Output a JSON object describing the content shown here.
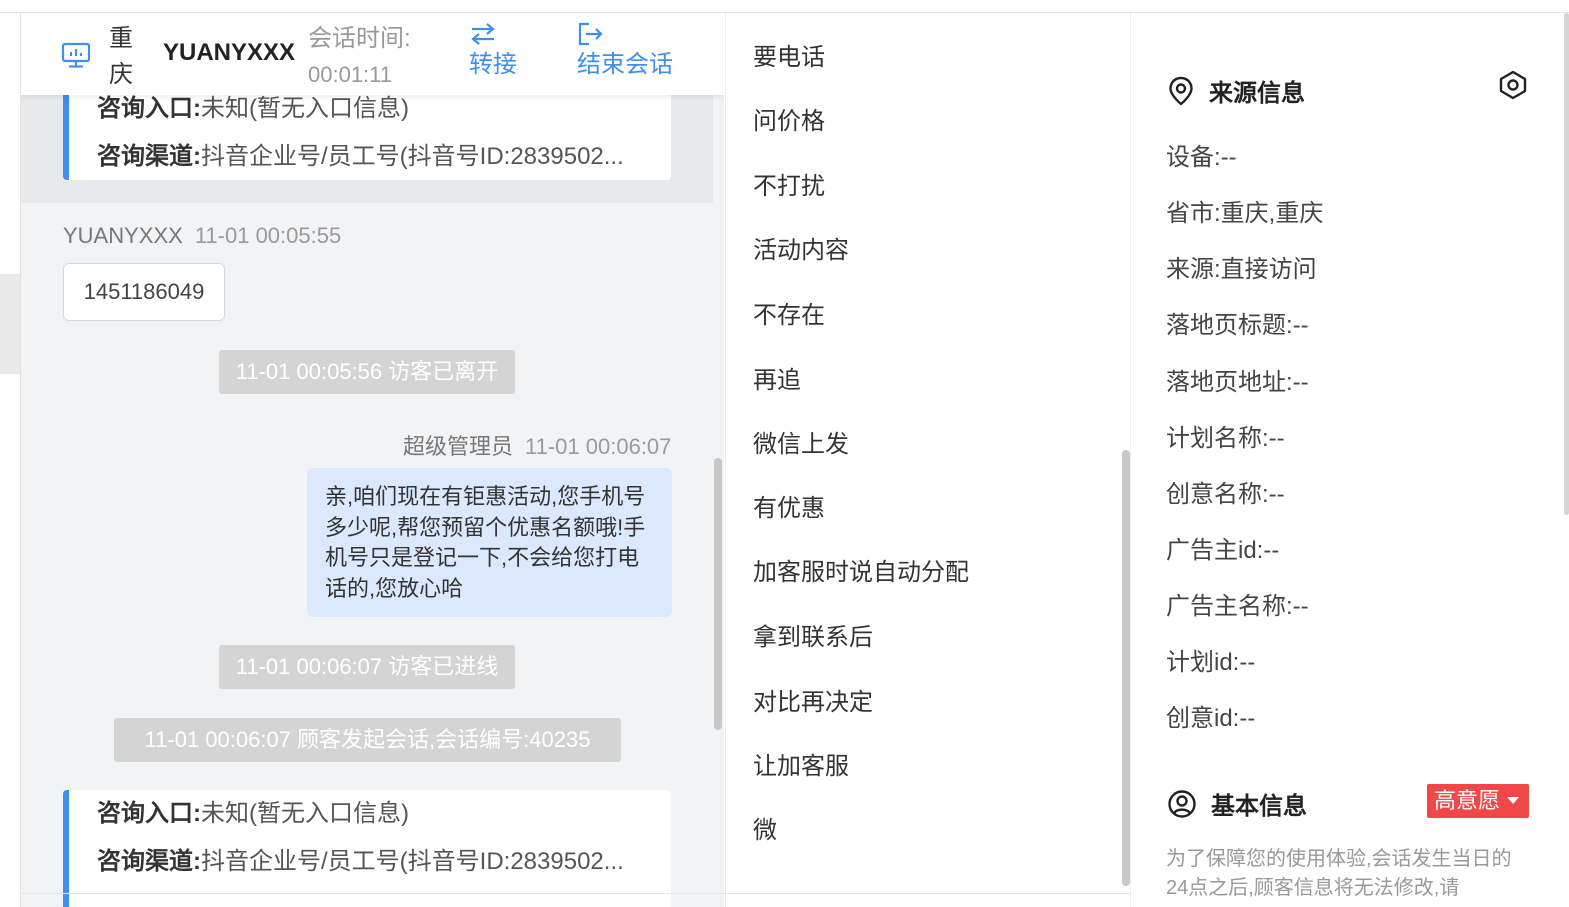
{
  "header": {
    "city": "重庆",
    "visitor_name": "YUANYXXX",
    "session_time_label": "会话时间:",
    "session_time_value": "00:01:11",
    "transfer_label": "转接",
    "end_label": "结束会话"
  },
  "chat": {
    "card_top": {
      "entry_label": "咨询入口:",
      "entry_value": "未知(暂无入口信息)",
      "channel_label": "咨询渠道:",
      "channel_value": "抖音企业号/员工号(抖音号ID:2839502..."
    },
    "visitor_msg": {
      "sender": "YUANYXXX",
      "time": "11-01 00:05:55",
      "text": "1451186049"
    },
    "sys_left": "11-01 00:05:56 访客已离开",
    "agent_msg": {
      "sender": "超级管理员",
      "time": "11-01 00:06:07",
      "text": "亲,咱们现在有钜惠活动,您手机号多少呢,帮您预留个优惠名额哦!手机号只是登记一下,不会给您打电话的,您放心哈"
    },
    "sys_online": "11-01 00:06:07 访客已进线",
    "sys_start": "11-01 00:06:07 顾客发起会话,会话编号:40235",
    "card_bottom": {
      "entry_label": "咨询入口:",
      "entry_value": "未知(暂无入口信息)",
      "channel_label": "咨询渠道:",
      "channel_value": "抖音企业号/员工号(抖音号ID:2839502..."
    }
  },
  "quick_replies": [
    "要电话",
    "问价格",
    "不打扰",
    "活动内容",
    "不存在",
    "再追",
    "微信上发",
    "有优惠",
    "加客服时说自动分配",
    "拿到联系后",
    "对比再决定",
    "让加客服",
    "微"
  ],
  "source": {
    "title": "来源信息",
    "fields": [
      "设备:--",
      "省市:重庆,重庆",
      "来源:直接访问",
      "落地页标题:--",
      "落地页地址:--",
      "计划名称:--",
      "创意名称:--",
      "广告主id:--",
      "广告主名称:--",
      "计划id:--",
      "创意id:--"
    ]
  },
  "basic": {
    "title": "基本信息",
    "intent_badge": "高意愿",
    "notice": "为了保障您的使用体验,会话发生当日的24点之后,顾客信息将无法修改,请"
  },
  "colors": {
    "accent": "#3f8ef0",
    "agent_bubble": "#dbe8fd",
    "badge_red": "#f04848",
    "chat_bg": "#f2f3f5"
  }
}
